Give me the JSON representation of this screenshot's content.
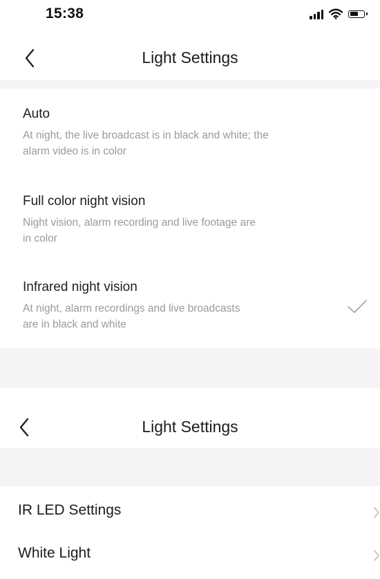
{
  "status_bar": {
    "time": "15:38",
    "icons": [
      "signal-icon",
      "wifi-icon",
      "battery-icon"
    ]
  },
  "screen_top": {
    "nav": {
      "title": "Light Settings",
      "back_icon": "chevron-left-icon"
    },
    "options": [
      {
        "title": "Auto",
        "description_lines": [
          "At night, the live broadcast is in black and white; the",
          "alarm video is in color"
        ],
        "selected": false
      },
      {
        "title": "Full color night vision",
        "description_lines": [
          "Night vision, alarm recording and live footage are",
          "in color"
        ],
        "selected": false
      },
      {
        "title": "Infrared night vision",
        "description_lines": [
          "At night, alarm recordings and live broadcasts",
          "are in black and white"
        ],
        "selected": true
      }
    ]
  },
  "screen_bottom": {
    "nav": {
      "title": "Light Settings",
      "back_icon": "chevron-left-icon"
    },
    "rows": [
      {
        "label": "IR LED Settings",
        "icon": "chevron-right-icon"
      },
      {
        "label": "White Light",
        "icon": "chevron-right-icon"
      }
    ]
  },
  "colors": {
    "background": "#ffffff",
    "section_gray": "#f4f4f6",
    "secondary_text": "#9a9a9a",
    "primary_text": "#1e1e1e",
    "check": "#a8a8a8"
  }
}
